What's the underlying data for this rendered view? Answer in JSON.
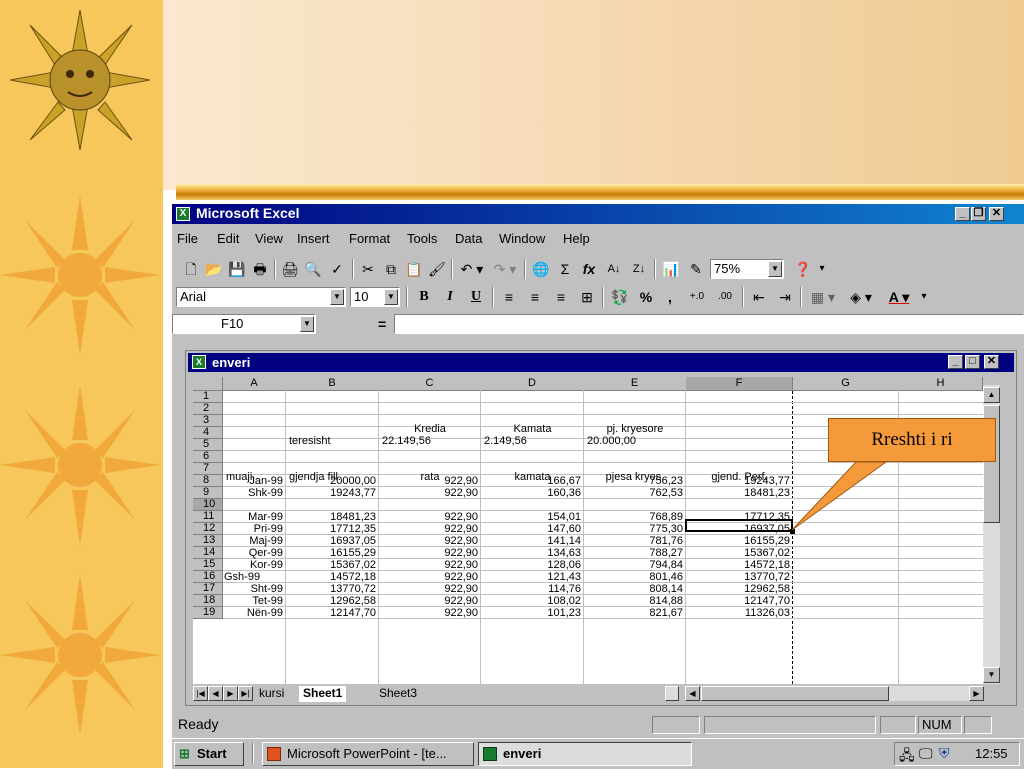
{
  "app": {
    "title": "Microsoft Excel",
    "menu": [
      "File",
      "Edit",
      "View",
      "Insert",
      "Format",
      "Tools",
      "Data",
      "Window",
      "Help"
    ],
    "zoom": "75%",
    "font_name": "Arial",
    "font_size": "10",
    "name_box": "F10",
    "formula_equals": "="
  },
  "workbook": {
    "title": "enveri",
    "columns": [
      "A",
      "B",
      "C",
      "D",
      "E",
      "F",
      "G",
      "H"
    ],
    "row_numbers": [
      "1",
      "2",
      "3",
      "4",
      "5",
      "6",
      "7",
      "8",
      "9",
      "10",
      "11",
      "12",
      "13",
      "14",
      "15",
      "16",
      "17",
      "18",
      "19"
    ],
    "selected_cell": "F10",
    "rows": {
      "r3": {
        "C": "Kredia",
        "D": "Kamata",
        "E": "pj. kryesore"
      },
      "r4": {
        "B": "teresisht",
        "C": "22.149,56",
        "D": "2.149,56",
        "E": "20.000,00"
      },
      "r7": {
        "A": "muaji",
        "B": "gjendja fill.",
        "C": "rata",
        "D": "kamata",
        "E": "pjesa kryes.",
        "F": "gjend. Perf."
      },
      "data": [
        {
          "A": "Jan-99",
          "B": "20000,00",
          "C": "922,90",
          "D": "166,67",
          "E": "756,23",
          "F": "19243,77"
        },
        {
          "A": "Shk-99",
          "B": "19243,77",
          "C": "922,90",
          "D": "160,36",
          "E": "762,53",
          "F": "18481,23"
        },
        {
          "A": "",
          "B": "",
          "C": "",
          "D": "",
          "E": "",
          "F": ""
        },
        {
          "A": "Mar-99",
          "B": "18481,23",
          "C": "922,90",
          "D": "154,01",
          "E": "768,89",
          "F": "17712,35"
        },
        {
          "A": "Pri-99",
          "B": "17712,35",
          "C": "922,90",
          "D": "147,60",
          "E": "775,30",
          "F": "16937,05"
        },
        {
          "A": "Maj-99",
          "B": "16937,05",
          "C": "922,90",
          "D": "141,14",
          "E": "781,76",
          "F": "16155,29"
        },
        {
          "A": "Qer-99",
          "B": "16155,29",
          "C": "922,90",
          "D": "134,63",
          "E": "788,27",
          "F": "15367,02"
        },
        {
          "A": "Kor-99",
          "B": "15367,02",
          "C": "922,90",
          "D": "128,06",
          "E": "794,84",
          "F": "14572,18"
        },
        {
          "A": "Gsh-99",
          "B": "14572,18",
          "C": "922,90",
          "D": "121,43",
          "E": "801,46",
          "F": "13770,72"
        },
        {
          "A": "Sht-99",
          "B": "13770,72",
          "C": "922,90",
          "D": "114,76",
          "E": "808,14",
          "F": "12962,58"
        },
        {
          "A": "Tet-99",
          "B": "12962,58",
          "C": "922,90",
          "D": "108,02",
          "E": "814,88",
          "F": "12147,70"
        },
        {
          "A": "Nën-99",
          "B": "12147,70",
          "C": "922,90",
          "D": "101,23",
          "E": "821,67",
          "F": "11326,03"
        }
      ]
    },
    "sheet_tabs": [
      "kursi",
      "Sheet1",
      "Sheet3"
    ],
    "active_tab": "Sheet1"
  },
  "status": {
    "ready": "Ready",
    "num": "NUM"
  },
  "taskbar": {
    "start": "Start",
    "items": [
      "Microsoft PowerPoint - [te...",
      "enveri"
    ],
    "clock": "12:55"
  },
  "callout": {
    "text": "Rreshti i ri"
  },
  "colors": {
    "title_bar": "#000080",
    "callout_fill": "#f59a3a",
    "left_strip": "#f7c75c",
    "excel_green": "#1a7a2e"
  }
}
